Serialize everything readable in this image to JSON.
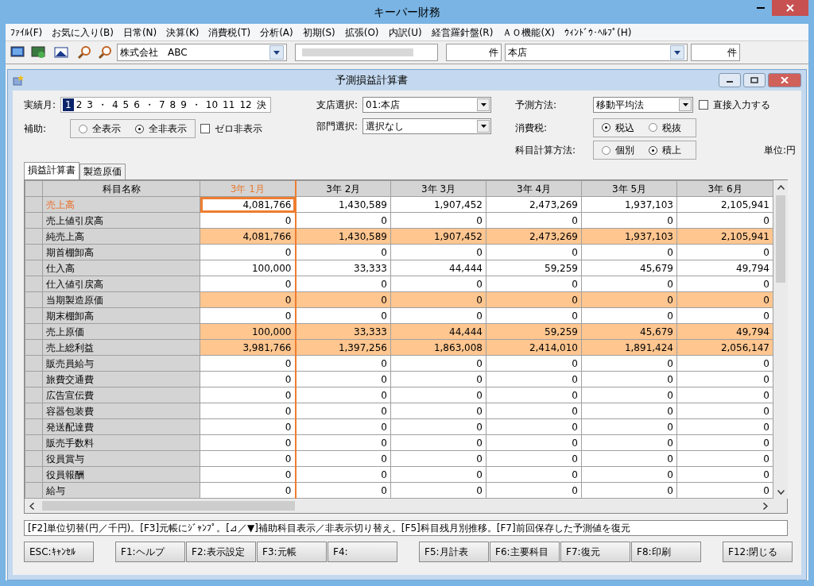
{
  "app": {
    "title": "キーパー財務"
  },
  "menu": [
    "ﾌｧｲﾙ(F)",
    "お気に入り(B)",
    "日常(N)",
    "決算(K)",
    "消費税(T)",
    "分析(A)",
    "初期(S)",
    "拡張(O)",
    "内訳(U)",
    "経営羅針盤(R)",
    "ＡＯ機能(X)",
    "ｳｨﾝﾄﾞｳ･ﾍﾙﾌﾟ(H)"
  ],
  "toolbar": {
    "company": "株式会社　ABC",
    "count_suffix_1": "件",
    "branch": "本店",
    "count_suffix_2": "件"
  },
  "window": {
    "title": "予測損益計算書"
  },
  "form": {
    "months_label": "実績月:",
    "months": [
      {
        "label": "1",
        "kind": "month",
        "selected": true
      },
      {
        "label": "2",
        "kind": "month",
        "selected": false
      },
      {
        "label": "3",
        "kind": "month",
        "selected": false
      },
      {
        "label": "・",
        "kind": "dot"
      },
      {
        "label": "4",
        "kind": "month",
        "selected": false
      },
      {
        "label": "5",
        "kind": "month",
        "selected": false
      },
      {
        "label": "6",
        "kind": "month",
        "selected": false
      },
      {
        "label": "・",
        "kind": "dot"
      },
      {
        "label": "7",
        "kind": "month",
        "selected": false
      },
      {
        "label": "8",
        "kind": "month",
        "selected": false
      },
      {
        "label": "9",
        "kind": "month",
        "selected": false
      },
      {
        "label": "・",
        "kind": "dot"
      },
      {
        "label": "10",
        "kind": "month",
        "selected": false
      },
      {
        "label": "11",
        "kind": "month",
        "selected": false
      },
      {
        "label": "12",
        "kind": "month",
        "selected": false
      },
      {
        "label": "決",
        "kind": "month",
        "selected": false
      }
    ],
    "aux_label": "補助:",
    "aux_options": [
      {
        "label": "全表示",
        "selected": false
      },
      {
        "label": "全非表示",
        "selected": true
      }
    ],
    "zero_hide": {
      "label": "ゼロ非表示",
      "checked": false
    },
    "branch_label": "支店選択:",
    "branch_value": "01:本店",
    "dept_label": "部門選択:",
    "dept_value": "選択なし",
    "method_label": "予測方法:",
    "method_value": "移動平均法",
    "direct_input": {
      "label": "直接入力する",
      "checked": false
    },
    "tax_label": "消費税:",
    "tax_options": [
      {
        "label": "税込",
        "selected": true
      },
      {
        "label": "税抜",
        "selected": false
      }
    ],
    "calc_label": "科目計算方法:",
    "calc_options": [
      {
        "label": "個別",
        "selected": false
      },
      {
        "label": "積上",
        "selected": true
      }
    ],
    "unit": "単位:円"
  },
  "tabs": [
    {
      "label": "損益計算書",
      "selected": true
    },
    {
      "label": "製造原価",
      "selected": false
    }
  ],
  "table": {
    "name_header": "科目名称",
    "columns": [
      {
        "label": "3年 1月",
        "selected": true
      },
      {
        "label": "3年 2月",
        "selected": false
      },
      {
        "label": "3年 3月",
        "selected": false
      },
      {
        "label": "3年 4月",
        "selected": false
      },
      {
        "label": "3年 5月",
        "selected": false
      },
      {
        "label": "3年 6月",
        "selected": false
      }
    ],
    "rows": [
      {
        "name": "売上高",
        "subtotal": false,
        "selected": true,
        "values": [
          "4,081,766",
          "1,430,589",
          "1,907,452",
          "2,473,269",
          "1,937,103",
          "2,105,941"
        ]
      },
      {
        "name": "売上値引戻高",
        "subtotal": false,
        "selected": false,
        "values": [
          "0",
          "0",
          "0",
          "0",
          "0",
          "0"
        ]
      },
      {
        "name": "純売上高",
        "subtotal": true,
        "selected": false,
        "values": [
          "4,081,766",
          "1,430,589",
          "1,907,452",
          "2,473,269",
          "1,937,103",
          "2,105,941"
        ]
      },
      {
        "name": "期首棚卸高",
        "subtotal": false,
        "selected": false,
        "values": [
          "0",
          "0",
          "0",
          "0",
          "0",
          "0"
        ]
      },
      {
        "name": "仕入高",
        "subtotal": false,
        "selected": false,
        "values": [
          "100,000",
          "33,333",
          "44,444",
          "59,259",
          "45,679",
          "49,794"
        ]
      },
      {
        "name": "仕入値引戻高",
        "subtotal": false,
        "selected": false,
        "values": [
          "0",
          "0",
          "0",
          "0",
          "0",
          "0"
        ]
      },
      {
        "name": "当期製造原価",
        "subtotal": true,
        "selected": false,
        "values": [
          "0",
          "0",
          "0",
          "0",
          "0",
          "0"
        ]
      },
      {
        "name": "期末棚卸高",
        "subtotal": false,
        "selected": false,
        "values": [
          "0",
          "0",
          "0",
          "0",
          "0",
          "0"
        ]
      },
      {
        "name": "売上原価",
        "subtotal": true,
        "selected": false,
        "values": [
          "100,000",
          "33,333",
          "44,444",
          "59,259",
          "45,679",
          "49,794"
        ]
      },
      {
        "name": "売上総利益",
        "subtotal": true,
        "selected": false,
        "values": [
          "3,981,766",
          "1,397,256",
          "1,863,008",
          "2,414,010",
          "1,891,424",
          "2,056,147"
        ]
      },
      {
        "name": "販売員給与",
        "subtotal": false,
        "selected": false,
        "values": [
          "0",
          "0",
          "0",
          "0",
          "0",
          "0"
        ]
      },
      {
        "name": "旅費交通費",
        "subtotal": false,
        "selected": false,
        "values": [
          "0",
          "0",
          "0",
          "0",
          "0",
          "0"
        ]
      },
      {
        "name": "広告宣伝費",
        "subtotal": false,
        "selected": false,
        "values": [
          "0",
          "0",
          "0",
          "0",
          "0",
          "0"
        ]
      },
      {
        "name": "容器包装費",
        "subtotal": false,
        "selected": false,
        "values": [
          "0",
          "0",
          "0",
          "0",
          "0",
          "0"
        ]
      },
      {
        "name": "発送配達費",
        "subtotal": false,
        "selected": false,
        "values": [
          "0",
          "0",
          "0",
          "0",
          "0",
          "0"
        ]
      },
      {
        "name": "販売手数料",
        "subtotal": false,
        "selected": false,
        "values": [
          "0",
          "0",
          "0",
          "0",
          "0",
          "0"
        ]
      },
      {
        "name": "役員賞与",
        "subtotal": false,
        "selected": false,
        "values": [
          "0",
          "0",
          "0",
          "0",
          "0",
          "0"
        ]
      },
      {
        "name": "役員報酬",
        "subtotal": false,
        "selected": false,
        "values": [
          "0",
          "0",
          "0",
          "0",
          "0",
          "0"
        ]
      },
      {
        "name": "給与",
        "subtotal": false,
        "selected": false,
        "values": [
          "0",
          "0",
          "0",
          "0",
          "0",
          "0"
        ]
      }
    ]
  },
  "hint": "[F2]単位切替(円／千円)。[F3]元帳にｼﾞｬﾝﾌﾟ。[⊿／▼]補助科目表示／非表示切り替え。[F5]科目残月別推移。[F7]前回保存した予測値を復元",
  "function_key_groups": [
    [
      "ESC:ｷｬﾝｾﾙ"
    ],
    [
      "F1:ヘルプ",
      "F2:表示設定",
      "F3:元帳",
      "F4:"
    ],
    [
      "F5:月計表",
      "F6:主要科目",
      "F7:復元",
      "F8:印刷"
    ],
    [
      "F12:閉じる"
    ]
  ]
}
